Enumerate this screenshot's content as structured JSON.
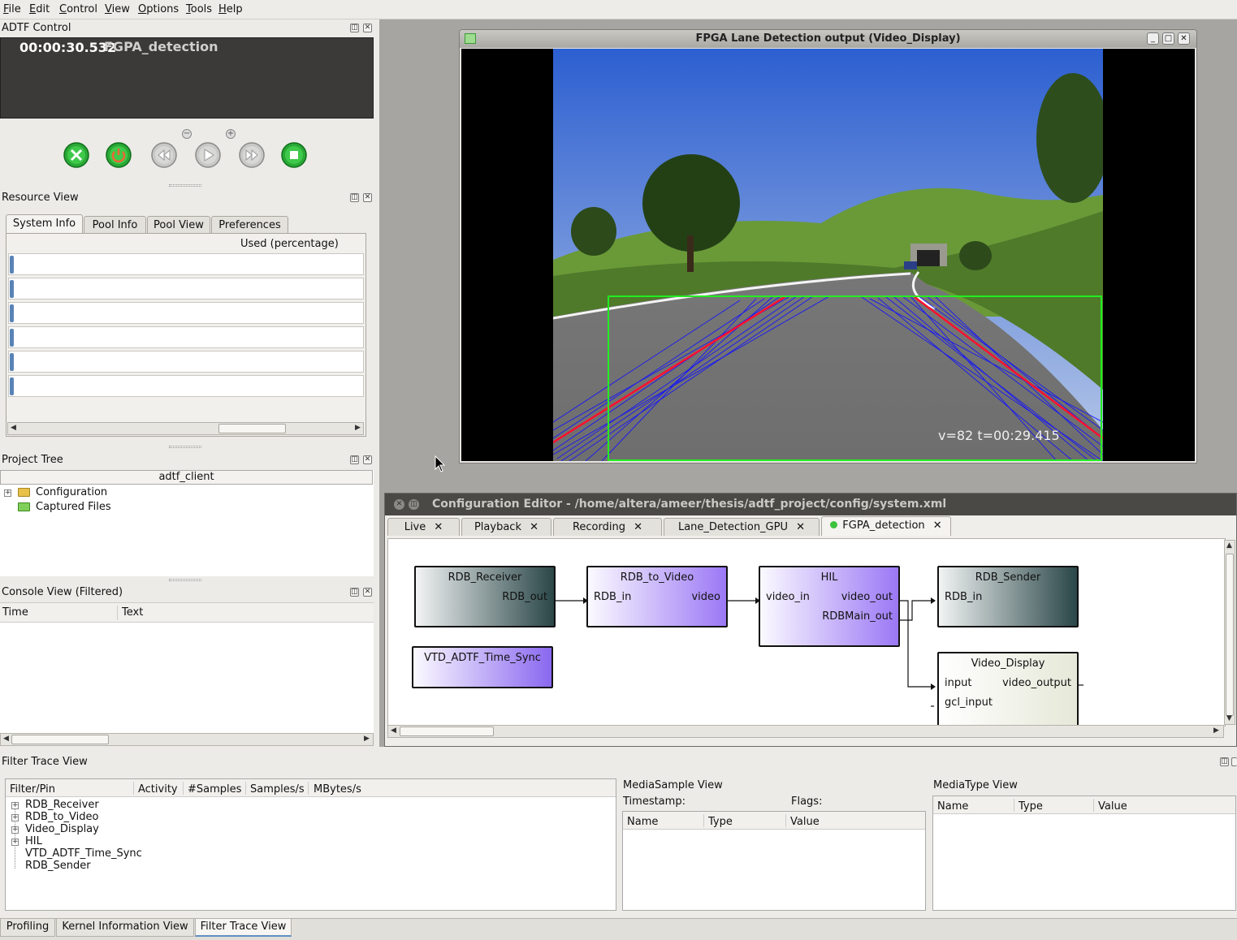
{
  "menu": [
    "File",
    "Edit",
    "Control",
    "View",
    "Options",
    "Tools",
    "Help"
  ],
  "adtf_control": {
    "title": "ADTF Control",
    "time": "00:00:30.532",
    "config_name": "FGPA_detection",
    "buttons": [
      "close",
      "power",
      "rewind",
      "play",
      "fast-forward",
      "stop"
    ]
  },
  "resource_view": {
    "title": "Resource View",
    "tabs": [
      "System Info",
      "Pool Info",
      "Pool View",
      "Preferences"
    ],
    "column": "Used (percentage)"
  },
  "project_tree": {
    "title": "Project Tree",
    "root": "adtf_client",
    "items": [
      "Configuration",
      "Captured Files"
    ]
  },
  "console_view": {
    "title": "Console View (Filtered)",
    "columns": [
      "Time",
      "Text"
    ]
  },
  "video_window": {
    "title": "FPGA Lane Detection output (Video_Display)",
    "overlay_text": "v=82 t=00:29.415"
  },
  "config_editor": {
    "title": "Configuration Editor - /home/altera/ameer/thesis/adtf_project/config/system.xml",
    "tabs": [
      "Live",
      "Playback",
      "Recording",
      "Lane_Detection_GPU",
      "FGPA_detection"
    ],
    "active_tab": "FGPA_detection",
    "nodes": {
      "rdb_receiver": {
        "name": "RDB_Receiver",
        "out": "RDB_out"
      },
      "rdb_to_video": {
        "name": "RDB_to_Video",
        "in": "RDB_in",
        "out": "video"
      },
      "hil": {
        "name": "HIL",
        "in": "video_in",
        "out1": "video_out",
        "out2": "RDBMain_out"
      },
      "rdb_sender": {
        "name": "RDB_Sender",
        "in": "RDB_in"
      },
      "vtd_sync": {
        "name": "VTD_ADTF_Time_Sync"
      },
      "video_display": {
        "name": "Video_Display",
        "in1": "input",
        "in2": "gcl_input",
        "out": "video_output"
      }
    }
  },
  "filter_trace": {
    "title": "Filter Trace View",
    "columns": [
      "Filter/Pin",
      "Activity",
      "#Samples",
      "Samples/s",
      "MBytes/s"
    ],
    "items": [
      "RDB_Receiver",
      "RDB_to_Video",
      "Video_Display",
      "HIL",
      "VTD_ADTF_Time_Sync",
      "RDB_Sender"
    ]
  },
  "media_sample": {
    "title": "MediaSample View",
    "timestamp_label": "Timestamp:",
    "flags_label": "Flags:",
    "columns": [
      "Name",
      "Type",
      "Value"
    ]
  },
  "media_type": {
    "title": "MediaType View",
    "columns": [
      "Name",
      "Type",
      "Value"
    ]
  },
  "bottom_tabs": [
    "Profiling",
    "Kernel Information View",
    "Filter Trace View"
  ],
  "colors": {
    "lane_lines": "#1010ff",
    "lane_center": "#ff1030",
    "roi_box": "#22ee22",
    "editor_titlebar": "#4a4945"
  }
}
